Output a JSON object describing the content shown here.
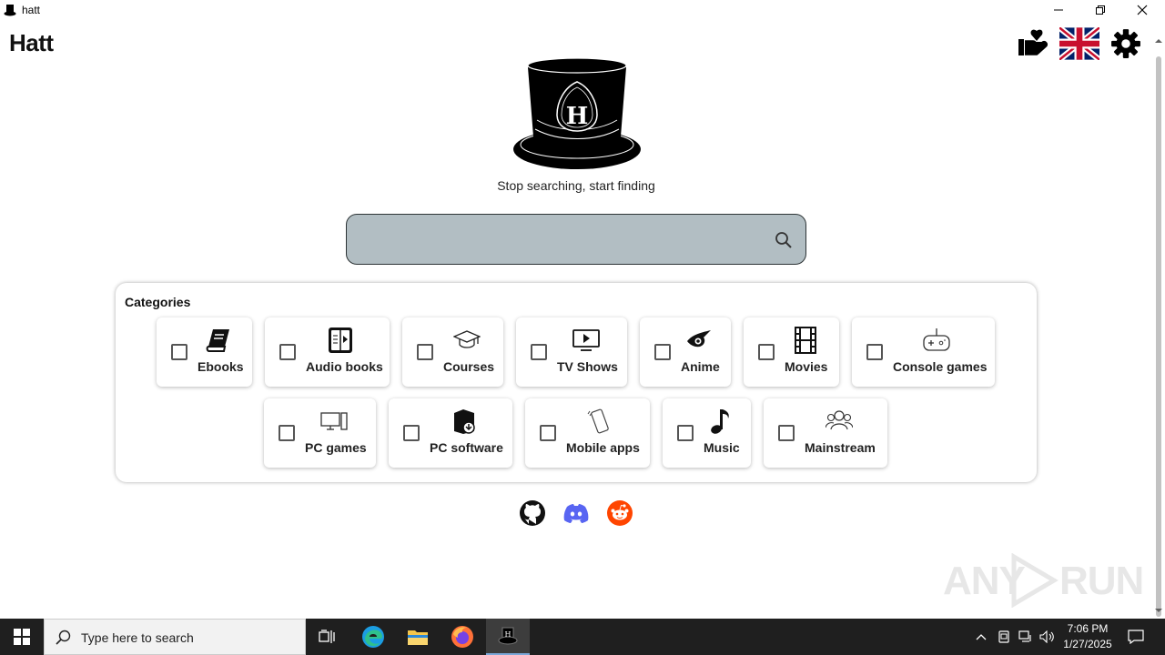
{
  "window": {
    "title": "hatt"
  },
  "header": {
    "brand": "Hatt"
  },
  "hero": {
    "tagline": "Stop searching, start finding",
    "logo_letter": "H"
  },
  "search": {
    "value": "",
    "placeholder": ""
  },
  "categories": {
    "title": "Categories",
    "row1": [
      {
        "label": "Ebooks",
        "icon": "book-icon"
      },
      {
        "label": "Audio books",
        "icon": "audiobook-icon"
      },
      {
        "label": "Courses",
        "icon": "graduation-cap-icon"
      },
      {
        "label": "TV Shows",
        "icon": "tv-icon"
      },
      {
        "label": "Anime",
        "icon": "anime-eye-icon"
      },
      {
        "label": "Movies",
        "icon": "film-strip-icon"
      },
      {
        "label": "Console games",
        "icon": "gamepad-icon"
      }
    ],
    "row2": [
      {
        "label": "PC games",
        "icon": "pc-icon"
      },
      {
        "label": "PC software",
        "icon": "software-box-icon"
      },
      {
        "label": "Mobile apps",
        "icon": "phone-icon"
      },
      {
        "label": "Music",
        "icon": "music-note-icon"
      },
      {
        "label": "Mainstream",
        "icon": "people-icon"
      }
    ]
  },
  "social": [
    "github-icon",
    "discord-icon",
    "reddit-icon"
  ],
  "watermark": {
    "left": "ANY",
    "right": "RUN"
  },
  "taskbar": {
    "search_placeholder": "Type here to search",
    "time": "7:06 PM",
    "date": "1/27/2025"
  },
  "colors": {
    "search_bg": "#b2bec3",
    "search_border": "#2d3436",
    "taskbar": "#1f1f1f"
  }
}
